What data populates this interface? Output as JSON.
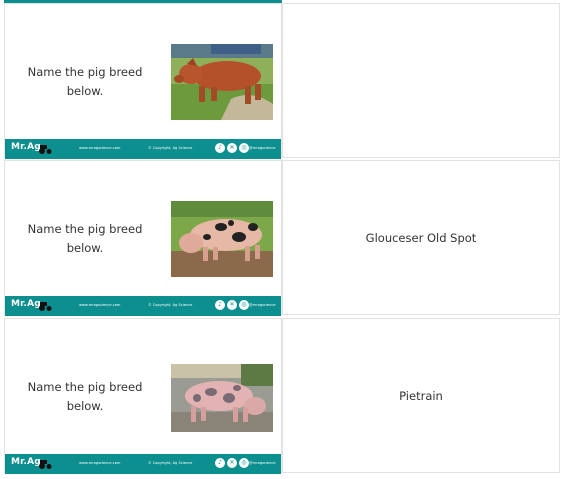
{
  "cards": [
    {
      "question": "Name the pig breed below.",
      "answer": "",
      "photo_icon": "red-pig-photo",
      "footer": {
        "logo": "Mr.Ag",
        "site": "www.mragscience.com",
        "copyright": "© Copyright, Ag Science",
        "handle": "@mragscience"
      }
    },
    {
      "question": "Name the pig breed below.",
      "answer": "Glouceser Old Spot",
      "photo_icon": "spotted-pig-photo",
      "footer": {
        "logo": "Mr.Ag",
        "site": "www.mragscience.com",
        "copyright": "© Copyright, Ag Science",
        "handle": "@mragscience"
      }
    },
    {
      "question": "Name the pig breed below.",
      "answer": "Pietrain",
      "photo_icon": "pietrain-pig-photo",
      "footer": {
        "logo": "Mr.Ag",
        "site": "www.mragscience.com",
        "copyright": "© Copyright, Ag Science",
        "handle": "@mragscience"
      }
    }
  ],
  "colors": {
    "brand_teal": "#0d8f8f",
    "border": "#e2e2e2",
    "text": "#333333"
  }
}
